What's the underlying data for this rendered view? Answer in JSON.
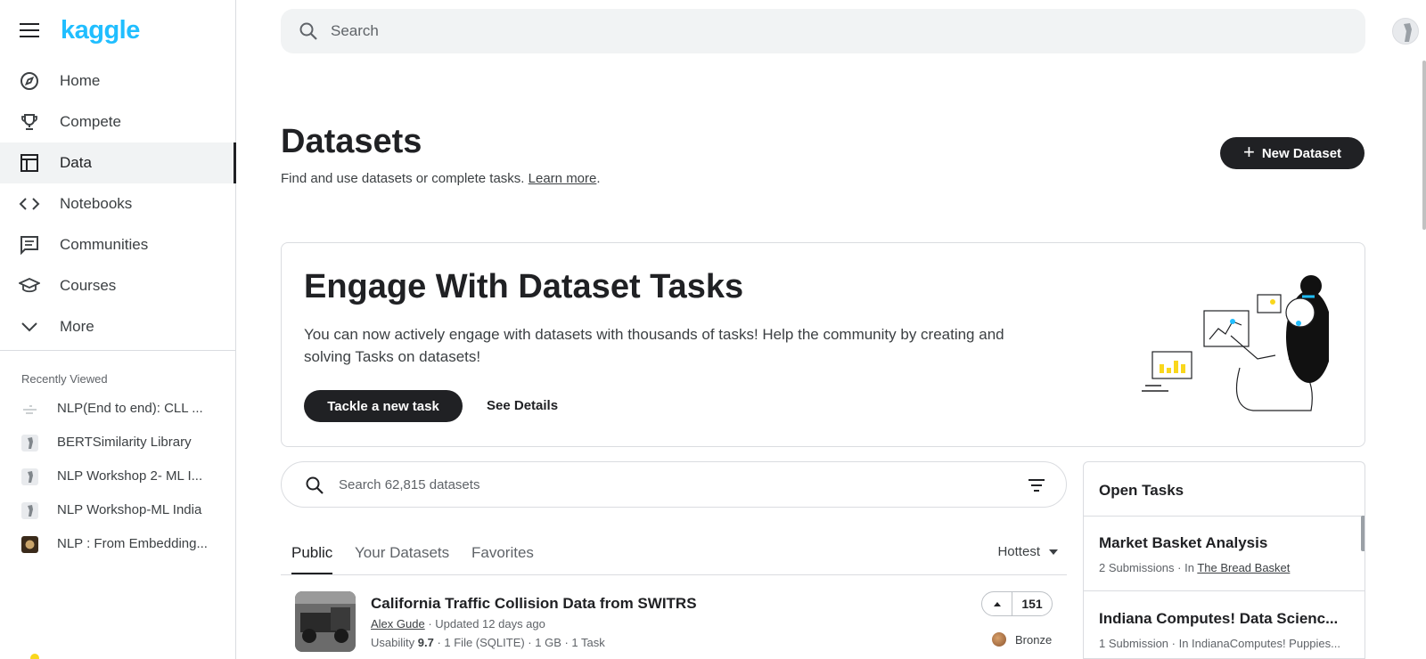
{
  "brand": {
    "logo": "kaggle"
  },
  "nav": [
    {
      "label": "Home",
      "icon": "compass-icon"
    },
    {
      "label": "Compete",
      "icon": "trophy-icon"
    },
    {
      "label": "Data",
      "icon": "table-icon",
      "active": true
    },
    {
      "label": "Notebooks",
      "icon": "code-icon"
    },
    {
      "label": "Communities",
      "icon": "comments-icon"
    },
    {
      "label": "Courses",
      "icon": "school-icon"
    },
    {
      "label": "More",
      "icon": "chevron-down-icon"
    }
  ],
  "recent": {
    "title": "Recently Viewed",
    "items": [
      {
        "label": "NLP(End to end): CLL ..."
      },
      {
        "label": "BERTSimilarity Library"
      },
      {
        "label": "NLP Workshop 2- ML I..."
      },
      {
        "label": "NLP Workshop-ML India"
      },
      {
        "label": "NLP : From Embedding..."
      }
    ]
  },
  "topbar": {
    "search_placeholder": "Search"
  },
  "header": {
    "title": "Datasets",
    "subtitle": "Find and use datasets or complete tasks.",
    "learn_more": "Learn more",
    "period": ".",
    "new_dataset": "New Dataset"
  },
  "banner": {
    "title": "Engage With Dataset Tasks",
    "description": "You can now actively engage with datasets with thousands of tasks! Help the community by creating and solving Tasks on datasets!",
    "primary_button": "Tackle a new task",
    "secondary_button": "See Details"
  },
  "dataset_search": {
    "placeholder": "Search 62,815 datasets"
  },
  "tabs": [
    {
      "label": "Public",
      "active": true
    },
    {
      "label": "Your Datasets"
    },
    {
      "label": "Favorites"
    }
  ],
  "sort": {
    "label": "Hottest"
  },
  "datasets": [
    {
      "title": "California Traffic Collision Data from SWITRS",
      "author": "Alex Gude",
      "updated": "· Updated 12 days ago",
      "usability_label": "Usability",
      "usability": "9.7",
      "details": "· 1 File (SQLITE) · 1 GB · 1 Task",
      "votes": "151",
      "medal": "Bronze"
    }
  ],
  "open_tasks": {
    "title": "Open Tasks",
    "items": [
      {
        "title": "Market Basket Analysis",
        "meta": "2 Submissions · In",
        "dataset": "The Bread Basket"
      },
      {
        "title": "Indiana Computes! Data Scienc...",
        "meta": "1 Submission · In IndianaComputes! Puppies...",
        "dataset": ""
      }
    ]
  },
  "colors": {
    "brand": "#20beff",
    "dark_button": "#202124",
    "medal_bronze": "#b06b3a"
  }
}
